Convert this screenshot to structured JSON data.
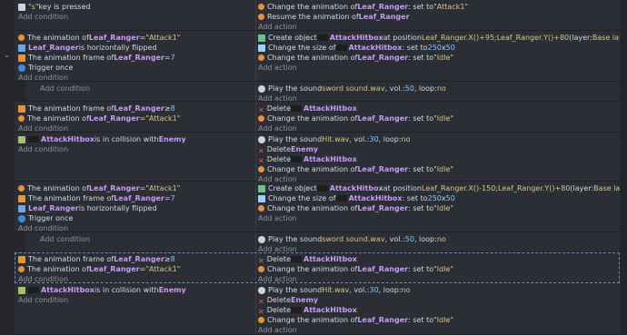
{
  "events": [
    {
      "id": "e0",
      "conditions": [
        {
          "icon": "keyboard-icon",
          "parts": [
            {
              "t": "\"s\"",
              "c": "str"
            },
            {
              "t": " key is pressed"
            }
          ]
        }
      ],
      "actions": [
        {
          "icon": "animation-icon",
          "parts": [
            {
              "t": "Change the animation of "
            },
            {
              "t": "Leaf_Ranger",
              "c": "obj"
            },
            {
              "t": ": set to "
            },
            {
              "t": "\"Attack1\"",
              "c": "str"
            }
          ]
        },
        {
          "icon": "animation-icon",
          "parts": [
            {
              "t": "Resume the animation of "
            },
            {
              "t": "Leaf_Ranger",
              "c": "obj"
            }
          ]
        }
      ]
    },
    {
      "id": "e1",
      "conditions": [
        {
          "icon": "animation-icon",
          "parts": [
            {
              "t": "The animation of "
            },
            {
              "t": "Leaf_Ranger",
              "c": "obj"
            },
            {
              "t": " = "
            },
            {
              "t": "\"Attack1\"",
              "c": "str"
            }
          ]
        },
        {
          "icon": "flip-icon",
          "parts": [
            {
              "t": "Leaf_Ranger",
              "c": "obj"
            },
            {
              "t": " is horizontally flipped"
            }
          ]
        },
        {
          "icon": "frame-icon",
          "parts": [
            {
              "t": "The animation frame of "
            },
            {
              "t": "Leaf_Ranger",
              "c": "obj"
            },
            {
              "t": " = "
            },
            {
              "t": "7",
              "c": "num"
            }
          ]
        },
        {
          "icon": "trigger-icon",
          "parts": [
            {
              "t": "Trigger once"
            }
          ]
        }
      ],
      "actions": [
        {
          "icon": "create-icon",
          "parts": [
            {
              "t": "Create object "
            },
            {
              "t": "AttackHitbox",
              "c": "obj"
            },
            {
              "t": " at position "
            },
            {
              "t": "Leaf_Ranger.X()+95;Leaf_Ranger.Y()+80",
              "c": "str"
            },
            {
              "t": " (layer: "
            },
            {
              "t": "Base layer",
              "c": "str"
            },
            {
              "t": ")"
            }
          ]
        },
        {
          "icon": "size-icon",
          "parts": [
            {
              "t": "Change the size of "
            },
            {
              "t": "AttackHitbox",
              "c": "obj"
            },
            {
              "t": ": set to "
            },
            {
              "t": "250",
              "c": "num"
            },
            {
              "t": " x "
            },
            {
              "t": "50",
              "c": "num"
            }
          ]
        },
        {
          "icon": "animation-icon",
          "parts": [
            {
              "t": "Change the animation of "
            },
            {
              "t": "Leaf_Ranger",
              "c": "obj"
            },
            {
              "t": ": set to "
            },
            {
              "t": "\"Idle\"",
              "c": "str"
            }
          ]
        }
      ]
    },
    {
      "id": "e2",
      "conditions": [],
      "actions": [
        {
          "icon": "sound-icon",
          "parts": [
            {
              "t": "Play the sound "
            },
            {
              "t": "sword sound.wav",
              "c": "str"
            },
            {
              "t": ", vol.: "
            },
            {
              "t": "50",
              "c": "num"
            },
            {
              "t": ", loop: "
            },
            {
              "t": "no",
              "c": "str"
            }
          ]
        }
      ]
    },
    {
      "id": "e3",
      "conditions": [
        {
          "icon": "frame-icon",
          "parts": [
            {
              "t": "The animation frame of "
            },
            {
              "t": "Leaf_Ranger",
              "c": "obj"
            },
            {
              "t": " ≥ "
            },
            {
              "t": "8",
              "c": "num"
            }
          ]
        },
        {
          "icon": "animation-icon",
          "parts": [
            {
              "t": "The animation of "
            },
            {
              "t": "Leaf_Ranger",
              "c": "obj"
            },
            {
              "t": " = "
            },
            {
              "t": "\"Attack1\"",
              "c": "str"
            }
          ]
        }
      ],
      "actions": [
        {
          "icon": "delete-icon",
          "parts": [
            {
              "t": "Delete "
            },
            {
              "t": "AttackHitbox",
              "c": "obj"
            }
          ]
        },
        {
          "icon": "animation-icon",
          "parts": [
            {
              "t": "Change the animation of "
            },
            {
              "t": "Leaf_Ranger",
              "c": "obj"
            },
            {
              "t": ": set to "
            },
            {
              "t": "\"Idle\"",
              "c": "str"
            }
          ]
        }
      ]
    },
    {
      "id": "e4",
      "conditions": [
        {
          "icon": "collision-icon",
          "parts": [
            {
              "t": "AttackHitbox",
              "c": "obj"
            },
            {
              "t": " is in collision with "
            },
            {
              "t": "Enemy",
              "c": "obj"
            }
          ]
        }
      ],
      "actions": [
        {
          "icon": "sound-icon",
          "parts": [
            {
              "t": "Play the sound "
            },
            {
              "t": "Hit.wav",
              "c": "str"
            },
            {
              "t": ", vol.: "
            },
            {
              "t": "30",
              "c": "num"
            },
            {
              "t": ", loop: "
            },
            {
              "t": "no",
              "c": "str"
            }
          ]
        },
        {
          "icon": "delete-icon",
          "parts": [
            {
              "t": "Delete "
            },
            {
              "t": "Enemy",
              "c": "obj"
            }
          ]
        },
        {
          "icon": "delete-icon",
          "parts": [
            {
              "t": "Delete "
            },
            {
              "t": "AttackHitbox",
              "c": "obj"
            }
          ]
        },
        {
          "icon": "animation-icon",
          "parts": [
            {
              "t": "Change the animation of "
            },
            {
              "t": "Leaf_Ranger",
              "c": "obj"
            },
            {
              "t": ": set to "
            },
            {
              "t": "\"Idle\"",
              "c": "str"
            }
          ]
        }
      ]
    },
    {
      "id": "e5",
      "conditions": [
        {
          "icon": "animation-icon",
          "parts": [
            {
              "t": "The animation of "
            },
            {
              "t": "Leaf_Ranger",
              "c": "obj"
            },
            {
              "t": " = "
            },
            {
              "t": "\"Attack1\"",
              "c": "str"
            }
          ]
        },
        {
          "icon": "frame-icon",
          "parts": [
            {
              "t": "The animation frame of "
            },
            {
              "t": "Leaf_Ranger",
              "c": "obj"
            },
            {
              "t": " = "
            },
            {
              "t": "7",
              "c": "num"
            }
          ]
        },
        {
          "icon": "flip-icon",
          "parts": [
            {
              "t": "Leaf_Ranger",
              "c": "obj"
            },
            {
              "t": " is horizontally flipped"
            }
          ]
        },
        {
          "icon": "trigger-icon",
          "parts": [
            {
              "t": "Trigger once"
            }
          ]
        }
      ],
      "actions": [
        {
          "icon": "create-icon",
          "parts": [
            {
              "t": "Create object "
            },
            {
              "t": "AttackHitbox",
              "c": "obj"
            },
            {
              "t": " at position "
            },
            {
              "t": "Leaf_Ranger.X()-150;Leaf_Ranger.Y()+80",
              "c": "str"
            },
            {
              "t": " (layer: "
            },
            {
              "t": "Base layer",
              "c": "str"
            },
            {
              "t": ")"
            }
          ]
        },
        {
          "icon": "size-icon",
          "parts": [
            {
              "t": "Change the size of "
            },
            {
              "t": "AttackHitbox",
              "c": "obj"
            },
            {
              "t": ": set to "
            },
            {
              "t": "250",
              "c": "num"
            },
            {
              "t": " x "
            },
            {
              "t": "50",
              "c": "num"
            }
          ]
        },
        {
          "icon": "animation-icon",
          "parts": [
            {
              "t": "Change the animation of "
            },
            {
              "t": "Leaf_Ranger",
              "c": "obj"
            },
            {
              "t": ": set to "
            },
            {
              "t": "\"Idle\"",
              "c": "str"
            }
          ]
        }
      ]
    },
    {
      "id": "e6",
      "conditions": [],
      "actions": [
        {
          "icon": "sound-icon",
          "parts": [
            {
              "t": "Play the sound "
            },
            {
              "t": "sword sound.wav",
              "c": "str"
            },
            {
              "t": ", vol.: "
            },
            {
              "t": "50",
              "c": "num"
            },
            {
              "t": ", loop: "
            },
            {
              "t": "no",
              "c": "str"
            }
          ]
        }
      ]
    },
    {
      "id": "e7",
      "conditions": [
        {
          "icon": "frame-icon",
          "parts": [
            {
              "t": "The animation frame of "
            },
            {
              "t": "Leaf_Ranger",
              "c": "obj"
            },
            {
              "t": " ≥ "
            },
            {
              "t": "8",
              "c": "num"
            }
          ]
        },
        {
          "icon": "animation-icon",
          "parts": [
            {
              "t": "The animation of "
            },
            {
              "t": "Leaf_Ranger",
              "c": "obj"
            },
            {
              "t": " = "
            },
            {
              "t": "\"Attack1\"",
              "c": "str"
            }
          ]
        }
      ],
      "actions": [
        {
          "icon": "delete-icon",
          "parts": [
            {
              "t": "Delete "
            },
            {
              "t": "AttackHitbox",
              "c": "obj"
            }
          ]
        },
        {
          "icon": "animation-icon",
          "parts": [
            {
              "t": "Change the animation of "
            },
            {
              "t": "Leaf_Ranger",
              "c": "obj"
            },
            {
              "t": ": set to "
            },
            {
              "t": "\"Idle\"",
              "c": "str"
            }
          ]
        }
      ]
    },
    {
      "id": "e8",
      "conditions": [
        {
          "icon": "collision-icon",
          "parts": [
            {
              "t": "AttackHitbox",
              "c": "obj"
            },
            {
              "t": " is in collision with "
            },
            {
              "t": "Enemy",
              "c": "obj"
            }
          ]
        }
      ],
      "actions": [
        {
          "icon": "sound-icon",
          "parts": [
            {
              "t": "Play the sound "
            },
            {
              "t": "Hit.wav",
              "c": "str"
            },
            {
              "t": ", vol.: "
            },
            {
              "t": "30",
              "c": "num"
            },
            {
              "t": ", loop: "
            },
            {
              "t": "no",
              "c": "str"
            }
          ]
        },
        {
          "icon": "delete-icon",
          "parts": [
            {
              "t": "Delete "
            },
            {
              "t": "Enemy",
              "c": "obj"
            }
          ]
        },
        {
          "icon": "delete-icon",
          "parts": [
            {
              "t": "Delete "
            },
            {
              "t": "AttackHitbox",
              "c": "obj"
            }
          ]
        },
        {
          "icon": "animation-icon",
          "parts": [
            {
              "t": "Change the animation of "
            },
            {
              "t": "Leaf_Ranger",
              "c": "obj"
            },
            {
              "t": ": set to "
            },
            {
              "t": "\"Idle\"",
              "c": "str"
            }
          ]
        }
      ]
    }
  ],
  "labels": {
    "add_condition": "Add condition",
    "add_action": "Add action"
  },
  "colors": {
    "background": "#25272d",
    "event_bg": "#2b2e35",
    "object_name": "#c69bf2",
    "string_value": "#d7c68c",
    "number_value": "#7fc8ff",
    "delete_icon": "#e85a5a"
  }
}
